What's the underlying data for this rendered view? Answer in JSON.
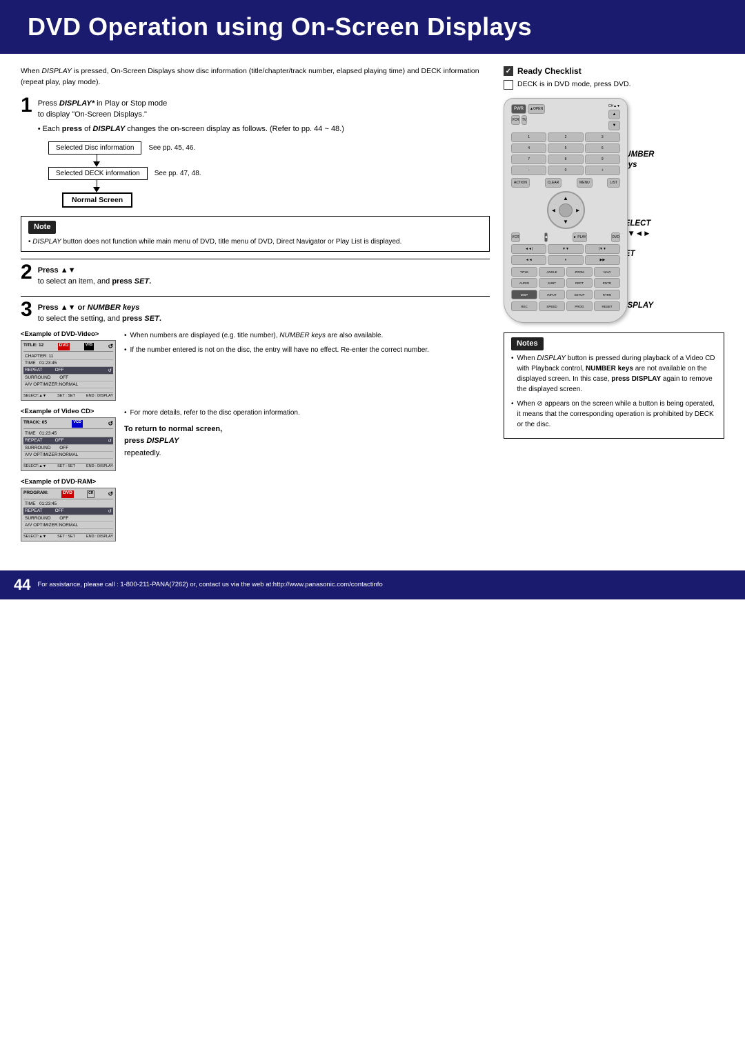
{
  "header": {
    "title": "DVD Operation using On-Screen Displays",
    "bg_color": "#1a1a6e"
  },
  "intro": {
    "text": "When DISPLAY is pressed, On-Screen Displays show disc information (title/chapter/track number, elapsed playing time) and DECK information (repeat play, play mode)."
  },
  "steps": [
    {
      "number": "1",
      "title": "Press DISPLAY* in Play or Stop mode",
      "subtitle": "to display \"On-Screen Displays.\"",
      "bullet": "Each press of DISPLAY changes the on-screen display as follows. (Refer to pp. 44 ~ 48.)",
      "flow": [
        {
          "label": "Selected Disc information",
          "note": "See pp. 45, 46."
        },
        {
          "label": "Selected DECK information",
          "note": "See pp. 47, 48."
        },
        {
          "label": "Normal Screen",
          "bold": true
        }
      ]
    },
    {
      "number": "2",
      "title": "Press ▲▼",
      "subtitle": "to select an item, and",
      "action": "press SET."
    },
    {
      "number": "3",
      "title": "Press ▲▼ or NUMBER keys",
      "subtitle": "to select the setting, and press SET."
    }
  ],
  "note": {
    "label": "Note",
    "text": "DISPLAY button does not function while main menu of DVD, title menu of DVD, Direct Navigator or Play List is displayed."
  },
  "examples": {
    "dvd_video": {
      "label": "<Example of DVD-Video>",
      "screen": {
        "title_row": [
          "TITLE: 12",
          "DVD"
        ],
        "rows": [
          [
            "CHAPTER: 11",
            "VHS"
          ],
          [
            "TIME   01:23:45",
            ""
          ],
          [
            "REPEAT OFF",
            "↺"
          ],
          [
            "SURROUND   OFF",
            ""
          ],
          [
            "A/V OPTIMIZER: NORMAL",
            ""
          ]
        ],
        "footer": [
          "SELECT:▲▼",
          "SET : SET",
          "END : DISPLAY"
        ]
      }
    },
    "video_cd": {
      "label": "<Example of Video CD>",
      "screen": {
        "title_row": [
          "TRACK: 05",
          "VCD"
        ],
        "rows": [
          [
            "TIME   01:23:45",
            ""
          ],
          [
            "REPEAT OFF",
            "↺"
          ],
          [
            "SURROUND   OFF",
            ""
          ],
          [
            "A/V OPTIMIZER: NORMAL",
            ""
          ]
        ],
        "footer": [
          "SELECT:▲▼",
          "SET : SET",
          "END : DISPLAY"
        ]
      }
    },
    "dvd_ram": {
      "label": "<Example of DVD-RAM>",
      "screen": {
        "title_row": [
          "PROGRAM:",
          "DVD"
        ],
        "rows": [
          [
            "TIME   01:23:45",
            ""
          ],
          [
            "REPEAT OFF",
            "↺"
          ],
          [
            "SURROUND   OFF",
            ""
          ],
          [
            "A/V OPTIMIZER: NORMAL",
            ""
          ]
        ],
        "footer": [
          "SELECT:▲▼",
          "SET : SET",
          "END : DISPLAY"
        ]
      }
    }
  },
  "example_notes": [
    "When numbers are displayed (e.g. title number), NUMBER keys are also available.",
    "If the number entered is not on the disc, the entry will have no effect. Re-enter the correct number.",
    "For more details, refer to the disc operation information."
  ],
  "return_section": {
    "heading": "To return to normal screen,",
    "text": "press DISPLAY repeatedly."
  },
  "ready_checklist": {
    "title": "Ready Checklist",
    "items": [
      {
        "checked": true,
        "text": ""
      },
      {
        "checked": false,
        "text": "DECK is in DVD mode, press DVD."
      }
    ]
  },
  "remote_labels": {
    "number_keys": "NUMBER\nkeys",
    "select": "SELECT\n▲▼◄►",
    "set": "SET",
    "display": "DISPLAY"
  },
  "notes_box": {
    "label": "Notes",
    "items": [
      "When DISPLAY button is pressed during playback of a Video CD with Playback control, NUMBER keys are not available on the displayed screen. In this case, press DISPLAY again to remove the displayed screen.",
      "When ⊘ appears on the screen while a button is being operated, it means that the corresponding operation is prohibited by DECK or the disc."
    ]
  },
  "footer": {
    "page_number": "44",
    "text": "For assistance, please call : 1-800-211-PANA(7262) or, contact us via the web at:http://www.panasonic.com/contactinfo"
  }
}
